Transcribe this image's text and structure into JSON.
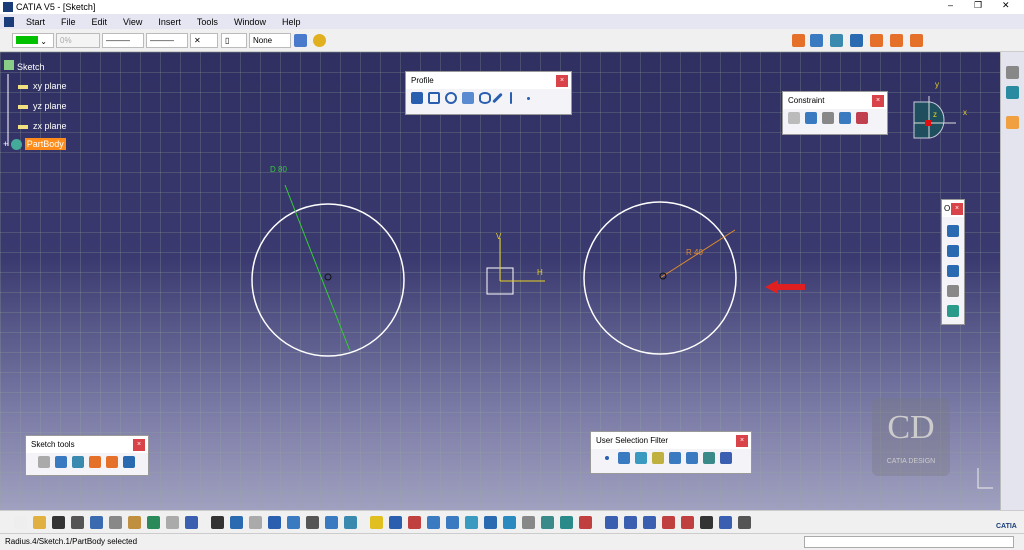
{
  "window": {
    "title": "CATIA V5 - [Sketch]",
    "min": "–",
    "restore": "❐",
    "close": "✕"
  },
  "menu": [
    "Start",
    "File",
    "Edit",
    "View",
    "Insert",
    "Tools",
    "Window",
    "Help"
  ],
  "toolbar": {
    "color": "#00c000",
    "transparency": "0%",
    "line_type_1": "———",
    "line_type_2": "———",
    "point_type": "✕",
    "layer": "None"
  },
  "tree": {
    "root": "Sketch",
    "items": [
      "xy plane",
      "yz plane",
      "zx plane"
    ],
    "selected": "PartBody"
  },
  "panels": {
    "profile": "Profile",
    "constraint": "Constraint",
    "operation": "O",
    "sketch_tools": "Sketch tools",
    "user_selection_filter": "User Selection Filter",
    "close": "×"
  },
  "sketch": {
    "diameter_label": "D 80",
    "radius_label": "R 40",
    "h_axis": "H",
    "v_axis": "V"
  },
  "compass": {
    "x": "x",
    "y": "y",
    "z": "z"
  },
  "watermark": "CATIA DESIGN",
  "status": {
    "text": "Radius.4/Sketch.1/PartBody selected"
  },
  "brand": "CATIA",
  "colors": {
    "accent": "#ff8c1a",
    "canvas_top": "#2f2f62",
    "dimension_green": "#33cc33",
    "dimension_orange": "#e08a2c"
  }
}
